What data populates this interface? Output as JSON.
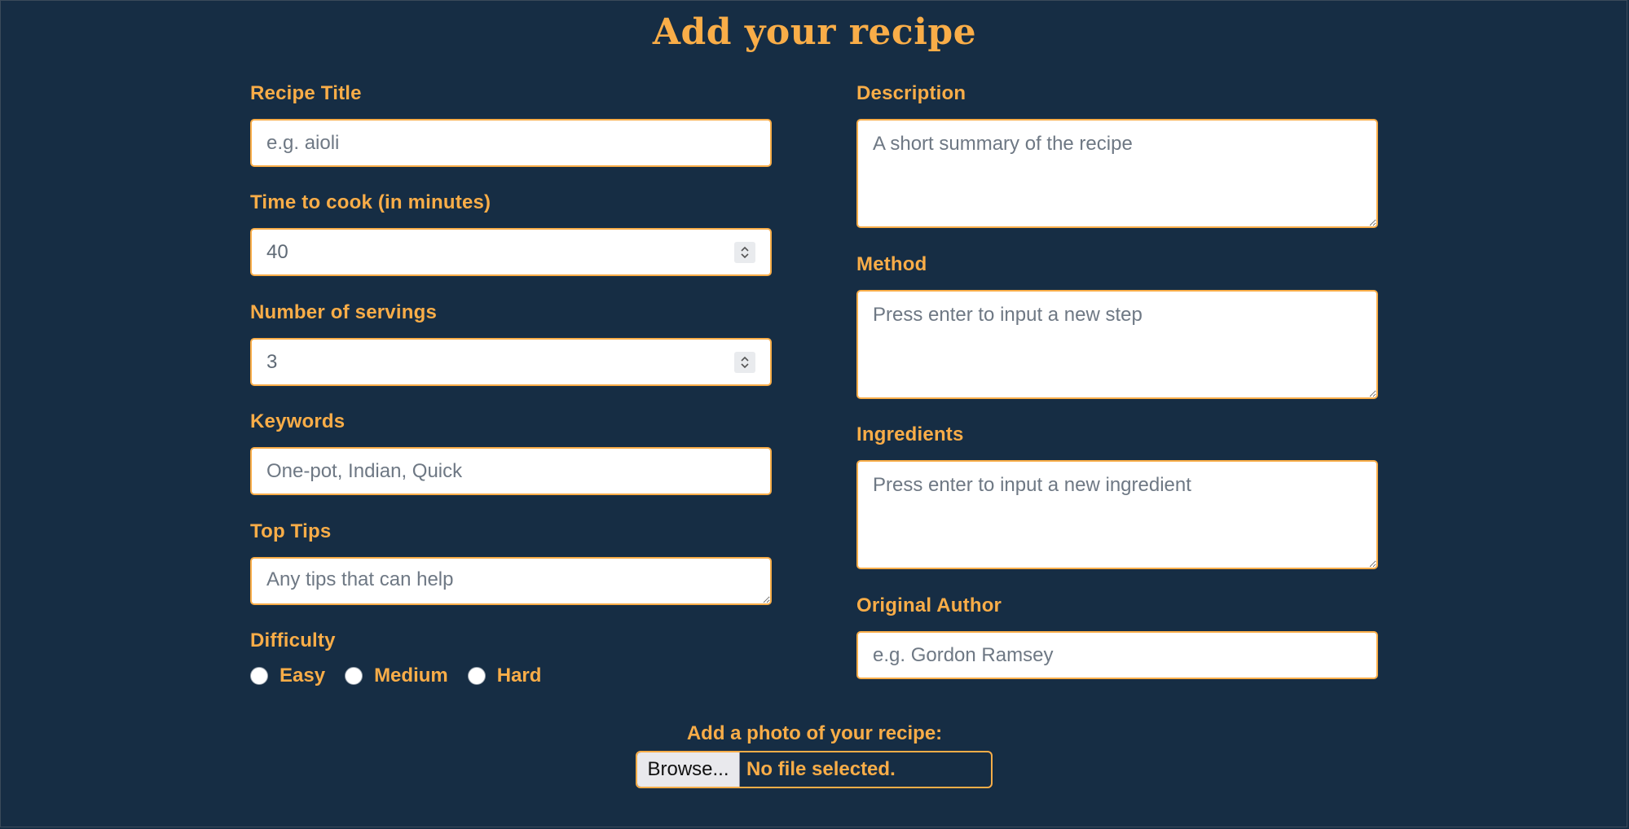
{
  "page": {
    "title": "Add your recipe"
  },
  "form": {
    "left": {
      "recipe_title": {
        "label": "Recipe Title",
        "placeholder": "e.g. aioli"
      },
      "time_to_cook": {
        "label": "Time to cook (in minutes)",
        "value": "40"
      },
      "servings": {
        "label": "Number of servings",
        "value": "3"
      },
      "keywords": {
        "label": "Keywords",
        "placeholder": "One-pot, Indian, Quick"
      },
      "top_tips": {
        "label": "Top Tips",
        "placeholder": "Any tips that can help"
      },
      "difficulty": {
        "label": "Difficulty",
        "options": [
          "Easy",
          "Medium",
          "Hard"
        ]
      }
    },
    "right": {
      "description": {
        "label": "Description",
        "placeholder": "A short summary of the recipe"
      },
      "method": {
        "label": "Method",
        "placeholder": "Press enter to input a new step"
      },
      "ingredients": {
        "label": "Ingredients",
        "placeholder": "Press enter to input a new ingredient"
      },
      "original_author": {
        "label": "Original Author",
        "placeholder": "e.g. Gordon Ramsey"
      }
    },
    "photo": {
      "label": "Add a photo of your recipe:",
      "browse_label": "Browse...",
      "status": "No file selected."
    }
  },
  "theme": {
    "background": "#162d44",
    "accent": "#f9ad48"
  }
}
